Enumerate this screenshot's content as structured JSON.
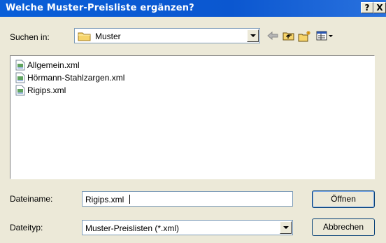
{
  "window": {
    "title": "Welche Muster-Preisliste ergänzen?",
    "help_label": "?",
    "close_label": "X"
  },
  "lookin": {
    "label": "Suchen in:",
    "value": "Muster",
    "icon": "folder-icon"
  },
  "toolbar": {
    "icons": [
      "back-icon",
      "up-one-level-icon",
      "new-folder-icon",
      "view-menu-icon"
    ]
  },
  "files": [
    {
      "name": "Allgemein.xml",
      "icon": "xml-file-icon"
    },
    {
      "name": "Hörmann-Stahlzargen.xml",
      "icon": "xml-file-icon"
    },
    {
      "name": "Rigips.xml",
      "icon": "xml-file-icon"
    }
  ],
  "filename": {
    "label": "Dateiname:",
    "value": "Rigips.xml"
  },
  "filetype": {
    "label": "Dateityp:",
    "value": "Muster-Preisliste­n (*.xml)"
  },
  "buttons": {
    "open": "Öffnen",
    "cancel": "Abbrechen"
  }
}
